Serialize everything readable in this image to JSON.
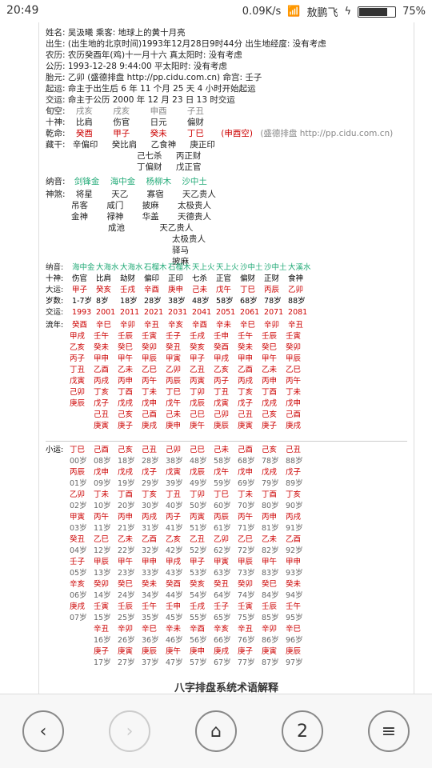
{
  "statusbar": {
    "time": "20:49",
    "net_speed": "0.09K/s",
    "carrier": "敖鹏飞",
    "battery_percent": "75%"
  },
  "header_lines": [
    {
      "key": "姓名: 吴汲曦      乘客:  地球上的黄十月亮"
    },
    {
      "key": "出生: (出生地的北京时间)1993年12月28日9时44分         出生地经度: 没有考虑"
    },
    {
      "key": "农历: 农历癸酉年(鸡)十一月十六          真太阳时: 没有考虑"
    },
    {
      "key": "公历: 1993-12-28 9:44:00            平太阳时: 没有考虑"
    },
    {
      "key": "胎元: 乙卯     (盛德排盘 http://pp.cidu.com.cn)     命宫: 壬子"
    },
    {
      "key": "起运: 命主于出生后 6 年 11 个月 25 天 4 小时开始起运"
    },
    {
      "key": "交运: 命主于公历 2000 年 12 月 23 日 13 时交运"
    }
  ],
  "pillars": {
    "labels": [
      "旬空:",
      "十神:",
      "乾命:",
      "藏干:"
    ],
    "xun_kong": [
      "戌亥",
      "戌亥",
      "申酉",
      "子丑"
    ],
    "ten_gods": [
      "比肩",
      "伤官",
      "日元",
      "偏财"
    ],
    "qian_ming": [
      "癸酉",
      "甲子",
      "癸未",
      "丁巳"
    ],
    "qian_ming_note": "(申酉空)",
    "site_note": "(盛德排盘 http://pp.cidu.com.cn)",
    "cang_gan": [
      [
        "辛偏印"
      ],
      [
        "癸比肩"
      ],
      [
        "乙食神",
        "己七杀",
        "丁偏财"
      ],
      [
        "庚正印",
        "丙正财",
        "戊正官"
      ]
    ]
  },
  "nayin": [
    "剑锋金",
    "海中金",
    "杨柳木",
    "沙中土"
  ],
  "shensha_title": "神煞:",
  "shensha_cols": [
    [
      "将星",
      "吊客",
      "金神"
    ],
    [
      "天乙",
      "咸门",
      "禄神",
      "成池"
    ],
    [
      "寡宿",
      "披麻",
      "华盖"
    ],
    [
      "天乙贵人",
      "太极贵人",
      "天德贵人",
      "天乙贵人",
      "太极贵人",
      "驿马",
      "披麻"
    ]
  ],
  "dayun": {
    "nayin_label": "纳音:",
    "nayin_row": [
      "海中金",
      "大海水",
      "大海水",
      "石榴木",
      "石榴木",
      "天上火",
      "天上火",
      "沙中土",
      "沙中土",
      "大溪水"
    ],
    "shishen_label": "十神:",
    "shishen_row": [
      "伤官",
      "比肩",
      "劫财",
      "偏印",
      "正印",
      "七杀",
      "正官",
      "偏财",
      "正财",
      "食神"
    ],
    "dayun_label": "大运:",
    "dayun_row": [
      "甲子",
      "癸亥",
      "壬戌",
      "辛酉",
      "庚申",
      "己未",
      "戊午",
      "丁巳",
      "丙辰",
      "乙卯"
    ],
    "age_label": "岁数:",
    "age_row": [
      "1-7岁",
      "8岁",
      "18岁",
      "28岁",
      "38岁",
      "48岁",
      "58岁",
      "68岁",
      "78岁",
      "88岁"
    ],
    "year_label": "交运:",
    "year_row": [
      "1993",
      "2001",
      "2011",
      "2021",
      "2031",
      "2041",
      "2051",
      "2061",
      "2071",
      "2081"
    ]
  },
  "liunian": {
    "label": "流年:",
    "header": [
      "癸酉",
      "辛巳",
      "辛卯",
      "辛丑",
      "辛亥",
      "辛酉",
      "辛未",
      "辛巳",
      "辛卯",
      "辛丑"
    ],
    "rows": [
      [
        "甲戌",
        "壬午",
        "壬辰",
        "壬寅",
        "壬子",
        "壬戌",
        "壬申",
        "壬午",
        "壬辰",
        "壬寅"
      ],
      [
        "乙亥",
        "癸未",
        "癸巳",
        "癸卯",
        "癸丑",
        "癸亥",
        "癸酉",
        "癸未",
        "癸巳",
        "癸卯"
      ],
      [
        "丙子",
        "甲申",
        "甲午",
        "甲辰",
        "甲寅",
        "甲子",
        "甲戌",
        "甲申",
        "甲午",
        "甲辰"
      ],
      [
        "丁丑",
        "乙酉",
        "乙未",
        "乙巳",
        "乙卯",
        "乙丑",
        "乙亥",
        "乙酉",
        "乙未",
        "乙巳"
      ],
      [
        "戊寅",
        "丙戌",
        "丙申",
        "丙午",
        "丙辰",
        "丙寅",
        "丙子",
        "丙戌",
        "丙申",
        "丙午"
      ],
      [
        "己卯",
        "丁亥",
        "丁酉",
        "丁未",
        "丁巳",
        "丁卯",
        "丁丑",
        "丁亥",
        "丁酉",
        "丁未"
      ],
      [
        "庚辰",
        "戊子",
        "戊戌",
        "戊申",
        "戊午",
        "戊辰",
        "戊寅",
        "戊子",
        "戊戌",
        "戊申"
      ],
      [
        "",
        "己丑",
        "己亥",
        "己酉",
        "己未",
        "己巳",
        "己卯",
        "己丑",
        "己亥",
        "己酉"
      ],
      [
        "",
        "庚寅",
        "庚子",
        "庚戌",
        "庚申",
        "庚午",
        "庚辰",
        "庚寅",
        "庚子",
        "庚戌"
      ]
    ]
  },
  "xiaoyun": {
    "label": "小运:",
    "rows": [
      [
        "丁巳",
        "己酉",
        "己亥",
        "己丑",
        "己卯",
        "己巳",
        "己未",
        "己酉",
        "己亥",
        "己丑"
      ],
      [
        "00岁",
        "08岁",
        "18岁",
        "28岁",
        "38岁",
        "48岁",
        "58岁",
        "68岁",
        "78岁",
        "88岁"
      ],
      [
        "丙辰",
        "戊申",
        "戊戌",
        "戊子",
        "戊寅",
        "戊辰",
        "戊午",
        "戊申",
        "戊戌",
        "戊子"
      ],
      [
        "01岁",
        "09岁",
        "19岁",
        "29岁",
        "39岁",
        "49岁",
        "59岁",
        "69岁",
        "79岁",
        "89岁"
      ],
      [
        "乙卯",
        "丁未",
        "丁酉",
        "丁亥",
        "丁丑",
        "丁卯",
        "丁巳",
        "丁未",
        "丁酉",
        "丁亥"
      ],
      [
        "02岁",
        "10岁",
        "20岁",
        "30岁",
        "40岁",
        "50岁",
        "60岁",
        "70岁",
        "80岁",
        "90岁"
      ],
      [
        "甲寅",
        "丙午",
        "丙申",
        "丙戌",
        "丙子",
        "丙寅",
        "丙辰",
        "丙午",
        "丙申",
        "丙戌"
      ],
      [
        "03岁",
        "11岁",
        "21岁",
        "31岁",
        "41岁",
        "51岁",
        "61岁",
        "71岁",
        "81岁",
        "91岁"
      ],
      [
        "癸丑",
        "乙巳",
        "乙未",
        "乙酉",
        "乙亥",
        "乙丑",
        "乙卯",
        "乙巳",
        "乙未",
        "乙酉"
      ],
      [
        "04岁",
        "12岁",
        "22岁",
        "32岁",
        "42岁",
        "52岁",
        "62岁",
        "72岁",
        "82岁",
        "92岁"
      ],
      [
        "壬子",
        "甲辰",
        "甲午",
        "甲申",
        "甲戌",
        "甲子",
        "甲寅",
        "甲辰",
        "甲午",
        "甲申"
      ],
      [
        "05岁",
        "13岁",
        "23岁",
        "33岁",
        "43岁",
        "53岁",
        "63岁",
        "73岁",
        "83岁",
        "93岁"
      ],
      [
        "辛亥",
        "癸卯",
        "癸巳",
        "癸未",
        "癸酉",
        "癸亥",
        "癸丑",
        "癸卯",
        "癸巳",
        "癸未"
      ],
      [
        "06岁",
        "14岁",
        "24岁",
        "34岁",
        "44岁",
        "54岁",
        "64岁",
        "74岁",
        "84岁",
        "94岁"
      ],
      [
        "庚戌",
        "壬寅",
        "壬辰",
        "壬午",
        "壬申",
        "壬戌",
        "壬子",
        "壬寅",
        "壬辰",
        "壬午"
      ],
      [
        "07岁",
        "15岁",
        "25岁",
        "35岁",
        "45岁",
        "55岁",
        "65岁",
        "75岁",
        "85岁",
        "95岁"
      ],
      [
        "",
        "辛丑",
        "辛卯",
        "辛巳",
        "辛未",
        "辛酉",
        "辛亥",
        "辛丑",
        "辛卯",
        "辛巳"
      ],
      [
        "",
        "16岁",
        "26岁",
        "36岁",
        "46岁",
        "56岁",
        "66岁",
        "76岁",
        "86岁",
        "96岁"
      ],
      [
        "",
        "庚子",
        "庚寅",
        "庚辰",
        "庚午",
        "庚申",
        "庚戌",
        "庚子",
        "庚寅",
        "庚辰"
      ],
      [
        "",
        "17岁",
        "27岁",
        "37岁",
        "47岁",
        "57岁",
        "67岁",
        "77岁",
        "87岁",
        "97岁"
      ]
    ]
  },
  "footer_title": "八字排盘系统术语解释",
  "nav": {
    "back": "‹",
    "forward": "›",
    "home": "⌂",
    "tabs": "2",
    "menu": "≡"
  }
}
